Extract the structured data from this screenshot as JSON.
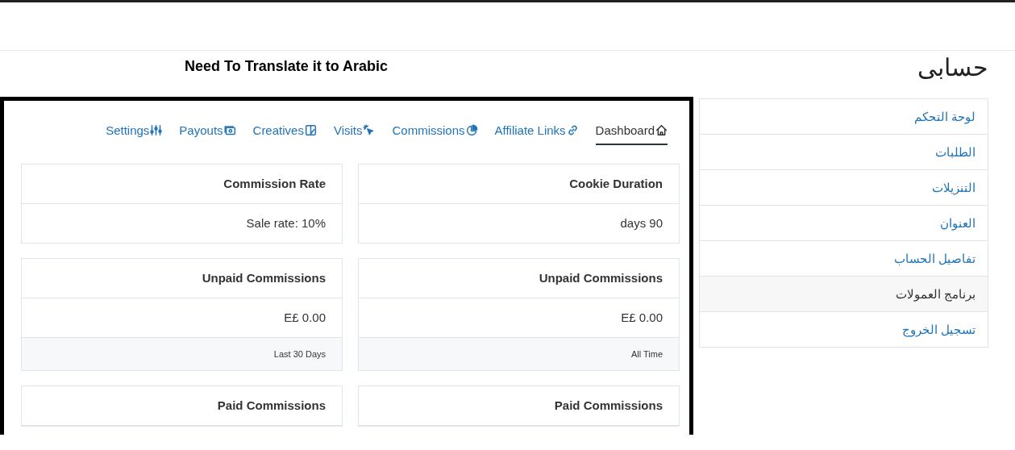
{
  "note": "Need To Translate it to Arabic",
  "tabs": [
    {
      "label": "Settings",
      "selected": false
    },
    {
      "label": "Payouts",
      "selected": false
    },
    {
      "label": "Creatives",
      "selected": false
    },
    {
      "label": "Visits",
      "selected": false
    },
    {
      "label": "Commissions",
      "selected": false
    },
    {
      "label": "Affiliate Links",
      "selected": false
    },
    {
      "label": "Dashboard",
      "selected": true
    }
  ],
  "cards": [
    {
      "title": "Commission Rate",
      "value": "Sale rate: 10%"
    },
    {
      "title": "Cookie Duration",
      "value": "days 90"
    },
    {
      "title": "Unpaid Commissions",
      "value": "E£ 0.00",
      "footer": "Last 30 Days"
    },
    {
      "title": "Unpaid Commissions",
      "value": "E£ 0.00",
      "footer": "All Time"
    },
    {
      "title": "Paid Commissions"
    },
    {
      "title": "Paid Commissions"
    }
  ],
  "sidebar": {
    "title": "حسابى",
    "items": [
      {
        "label": "لوحة التحكم",
        "selected": false
      },
      {
        "label": "الطلبات",
        "selected": false
      },
      {
        "label": "التنزيلات",
        "selected": false
      },
      {
        "label": "العنوان",
        "selected": false
      },
      {
        "label": "تفاصيل الحساب",
        "selected": false
      },
      {
        "label": "برنامج العمولات",
        "selected": true
      },
      {
        "label": "تسجيل الخروج",
        "selected": false
      }
    ]
  }
}
